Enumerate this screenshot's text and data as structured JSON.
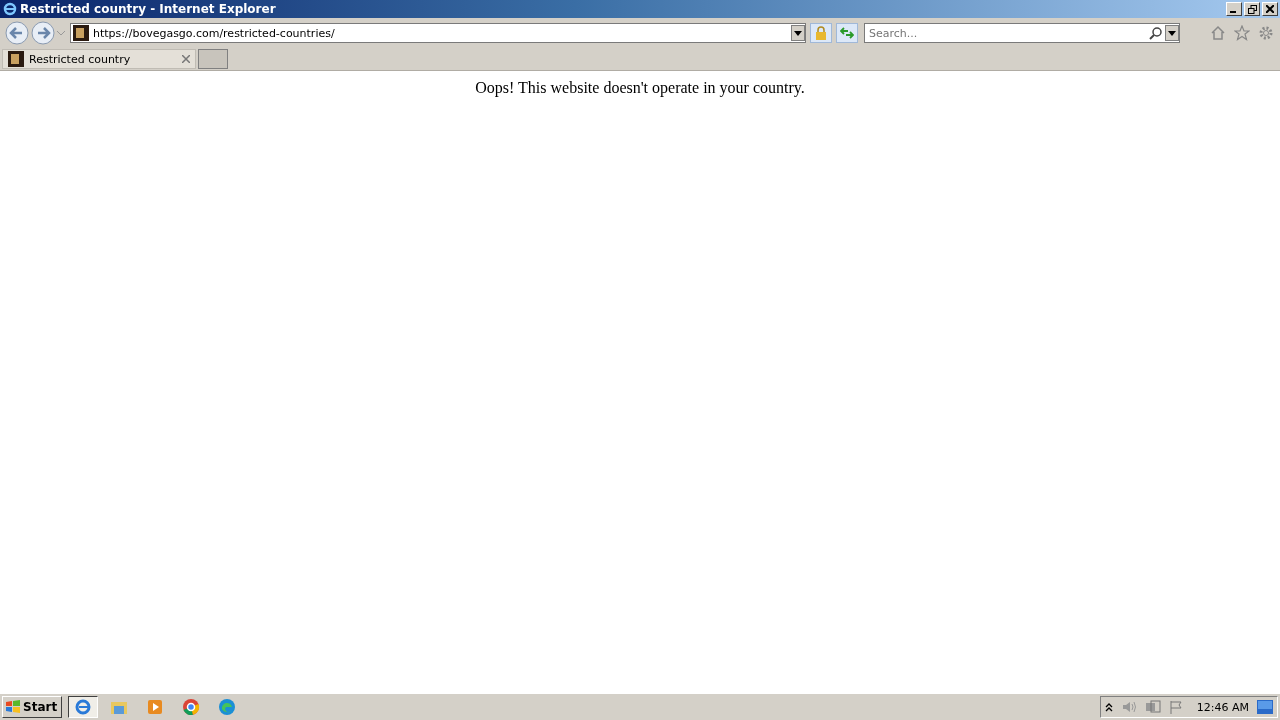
{
  "window": {
    "title": "Restricted country - Internet Explorer"
  },
  "address": {
    "url": "https://bovegasgo.com/restricted-countries/"
  },
  "search": {
    "placeholder": "Search..."
  },
  "tabs": [
    {
      "label": "Restricted country",
      "selected": true
    }
  ],
  "page": {
    "message": "Oops! This website doesn't operate in your country."
  },
  "taskbar": {
    "start": "Start",
    "apps": [
      {
        "kind": "ie",
        "selected": true
      },
      {
        "kind": "explorer",
        "selected": false
      },
      {
        "kind": "media",
        "selected": false
      },
      {
        "kind": "chrome",
        "selected": false
      },
      {
        "kind": "edge",
        "selected": false
      }
    ],
    "clock": "12:46 AM"
  }
}
